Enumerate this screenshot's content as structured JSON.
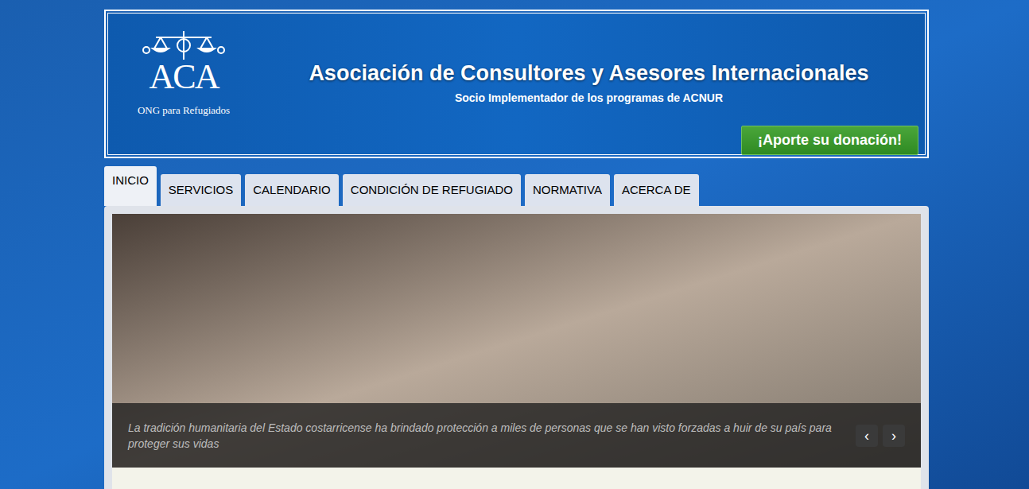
{
  "header": {
    "logo": {
      "letters": "ACA",
      "caption": "ONG para Refugiados"
    },
    "title": "Asociación de Consultores y Asesores Internacionales",
    "subtitle": "Socio Implementador de los programas de ACNUR",
    "donate_button": "¡Aporte su donación!"
  },
  "tabs": [
    {
      "label": "INICIO",
      "selected": true
    },
    {
      "label": "SERVICIOS",
      "selected": false
    },
    {
      "label": "CALENDARIO",
      "selected": false
    },
    {
      "label": "CONDICIÓN DE REFUGIADO",
      "selected": false
    },
    {
      "label": "NORMATIVA",
      "selected": false
    },
    {
      "label": "ACERCA DE",
      "selected": false
    }
  ],
  "slideshow": {
    "caption": "La tradición humanitaria del Estado costarricense ha brindado protección a miles de personas que se han visto forzadas a huir de su país para proteger sus vidas",
    "prev": "‹",
    "next": "›"
  }
}
